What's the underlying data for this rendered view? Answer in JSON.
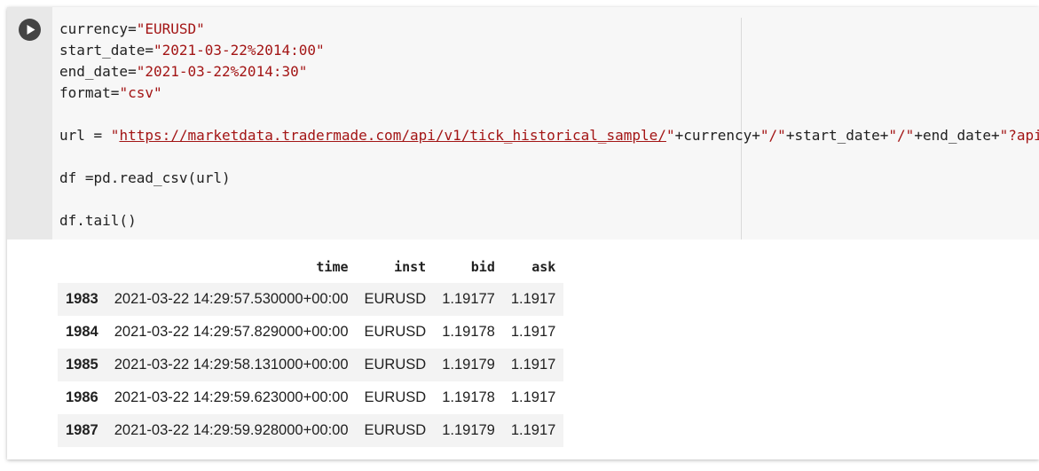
{
  "code_cell": {
    "lines": [
      [
        {
          "t": "currency="
        },
        {
          "t": "\"EURUSD\"",
          "c": "str"
        }
      ],
      [
        {
          "t": "start_date="
        },
        {
          "t": "\"2021-03-22%2014:00\"",
          "c": "str"
        }
      ],
      [
        {
          "t": "end_date="
        },
        {
          "t": "\"2021-03-22%2014:30\"",
          "c": "str"
        }
      ],
      [
        {
          "t": "format="
        },
        {
          "t": "\"csv\"",
          "c": "str"
        }
      ],
      [],
      [
        {
          "t": "url = "
        },
        {
          "t": "\"",
          "c": "str"
        },
        {
          "t": "https://marketdata.tradermade.com/api/v1/tick_historical_sample/",
          "c": "lnk"
        },
        {
          "t": "\"",
          "c": "str"
        },
        {
          "t": "+currency+"
        },
        {
          "t": "\"/\"",
          "c": "str"
        },
        {
          "t": "+start_date+"
        },
        {
          "t": "\"/\"",
          "c": "str"
        },
        {
          "t": "+end_date+"
        },
        {
          "t": "\"?api",
          "c": "str"
        }
      ],
      [],
      [
        {
          "t": "df =pd.read_csv(url)"
        }
      ],
      [],
      [
        {
          "t": "df.tail()"
        }
      ]
    ]
  },
  "output": {
    "columns": [
      "",
      "time",
      "inst",
      "bid",
      "ask"
    ],
    "rows": [
      [
        "1983",
        "2021-03-22 14:29:57.530000+00:00",
        "EURUSD",
        "1.19177",
        "1.1917"
      ],
      [
        "1984",
        "2021-03-22 14:29:57.829000+00:00",
        "EURUSD",
        "1.19178",
        "1.1917"
      ],
      [
        "1985",
        "2021-03-22 14:29:58.131000+00:00",
        "EURUSD",
        "1.19179",
        "1.1917"
      ],
      [
        "1986",
        "2021-03-22 14:29:59.623000+00:00",
        "EURUSD",
        "1.19178",
        "1.1917"
      ],
      [
        "1987",
        "2021-03-22 14:29:59.928000+00:00",
        "EURUSD",
        "1.19179",
        "1.1917"
      ]
    ]
  },
  "icons": {
    "run": "play-circle-icon"
  }
}
